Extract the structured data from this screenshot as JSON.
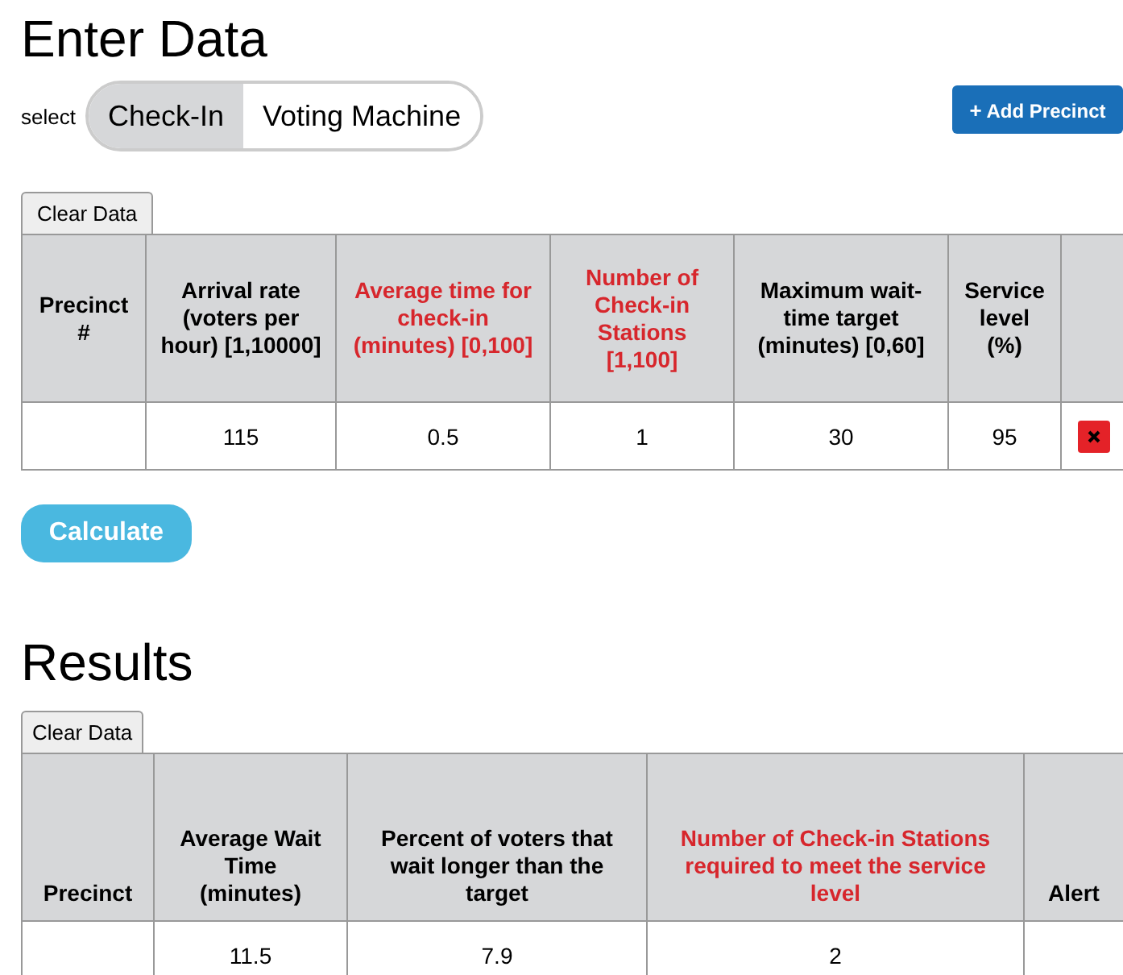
{
  "enter_title": "Enter Data",
  "select_label": "select",
  "mode_toggle": [
    {
      "label": "Check-In",
      "selected": true
    },
    {
      "label": "Voting Machine",
      "selected": false
    }
  ],
  "add_button": {
    "icon": "+",
    "label": "Add Precinct"
  },
  "input_table": {
    "clear_tab": "Clear Data",
    "columns": [
      {
        "label": "Precinct #",
        "highlight": false
      },
      {
        "label": "Arrival rate (voters per hour) [1,10000]",
        "highlight": false
      },
      {
        "label": "Average time for check-in (minutes) [0,100]",
        "highlight": true
      },
      {
        "label": "Number of Check-in Stations [1,100]",
        "highlight": true
      },
      {
        "label": "Maximum wait-time target (minutes) [0,60]",
        "highlight": false
      },
      {
        "label": "Service level (%)",
        "highlight": false
      }
    ],
    "rows": [
      {
        "cells": [
          "",
          "115",
          "0.5",
          "1",
          "30",
          "95"
        ],
        "deletable": true
      }
    ]
  },
  "calculate_button": "Calculate",
  "results_title": "Results",
  "results_table": {
    "clear_tab": "Clear Data",
    "columns": [
      {
        "label": "Precinct",
        "highlight": false
      },
      {
        "label": "Average Wait Time (minutes)",
        "highlight": false
      },
      {
        "label": "Percent of voters that wait longer than the target",
        "highlight": false
      },
      {
        "label": "Number of Check-in Stations required to meet the service level",
        "highlight": true
      },
      {
        "label": "Alert",
        "highlight": false
      }
    ],
    "rows": [
      {
        "cells": [
          "",
          "11.5",
          "7.9",
          "2",
          ""
        ]
      }
    ]
  }
}
